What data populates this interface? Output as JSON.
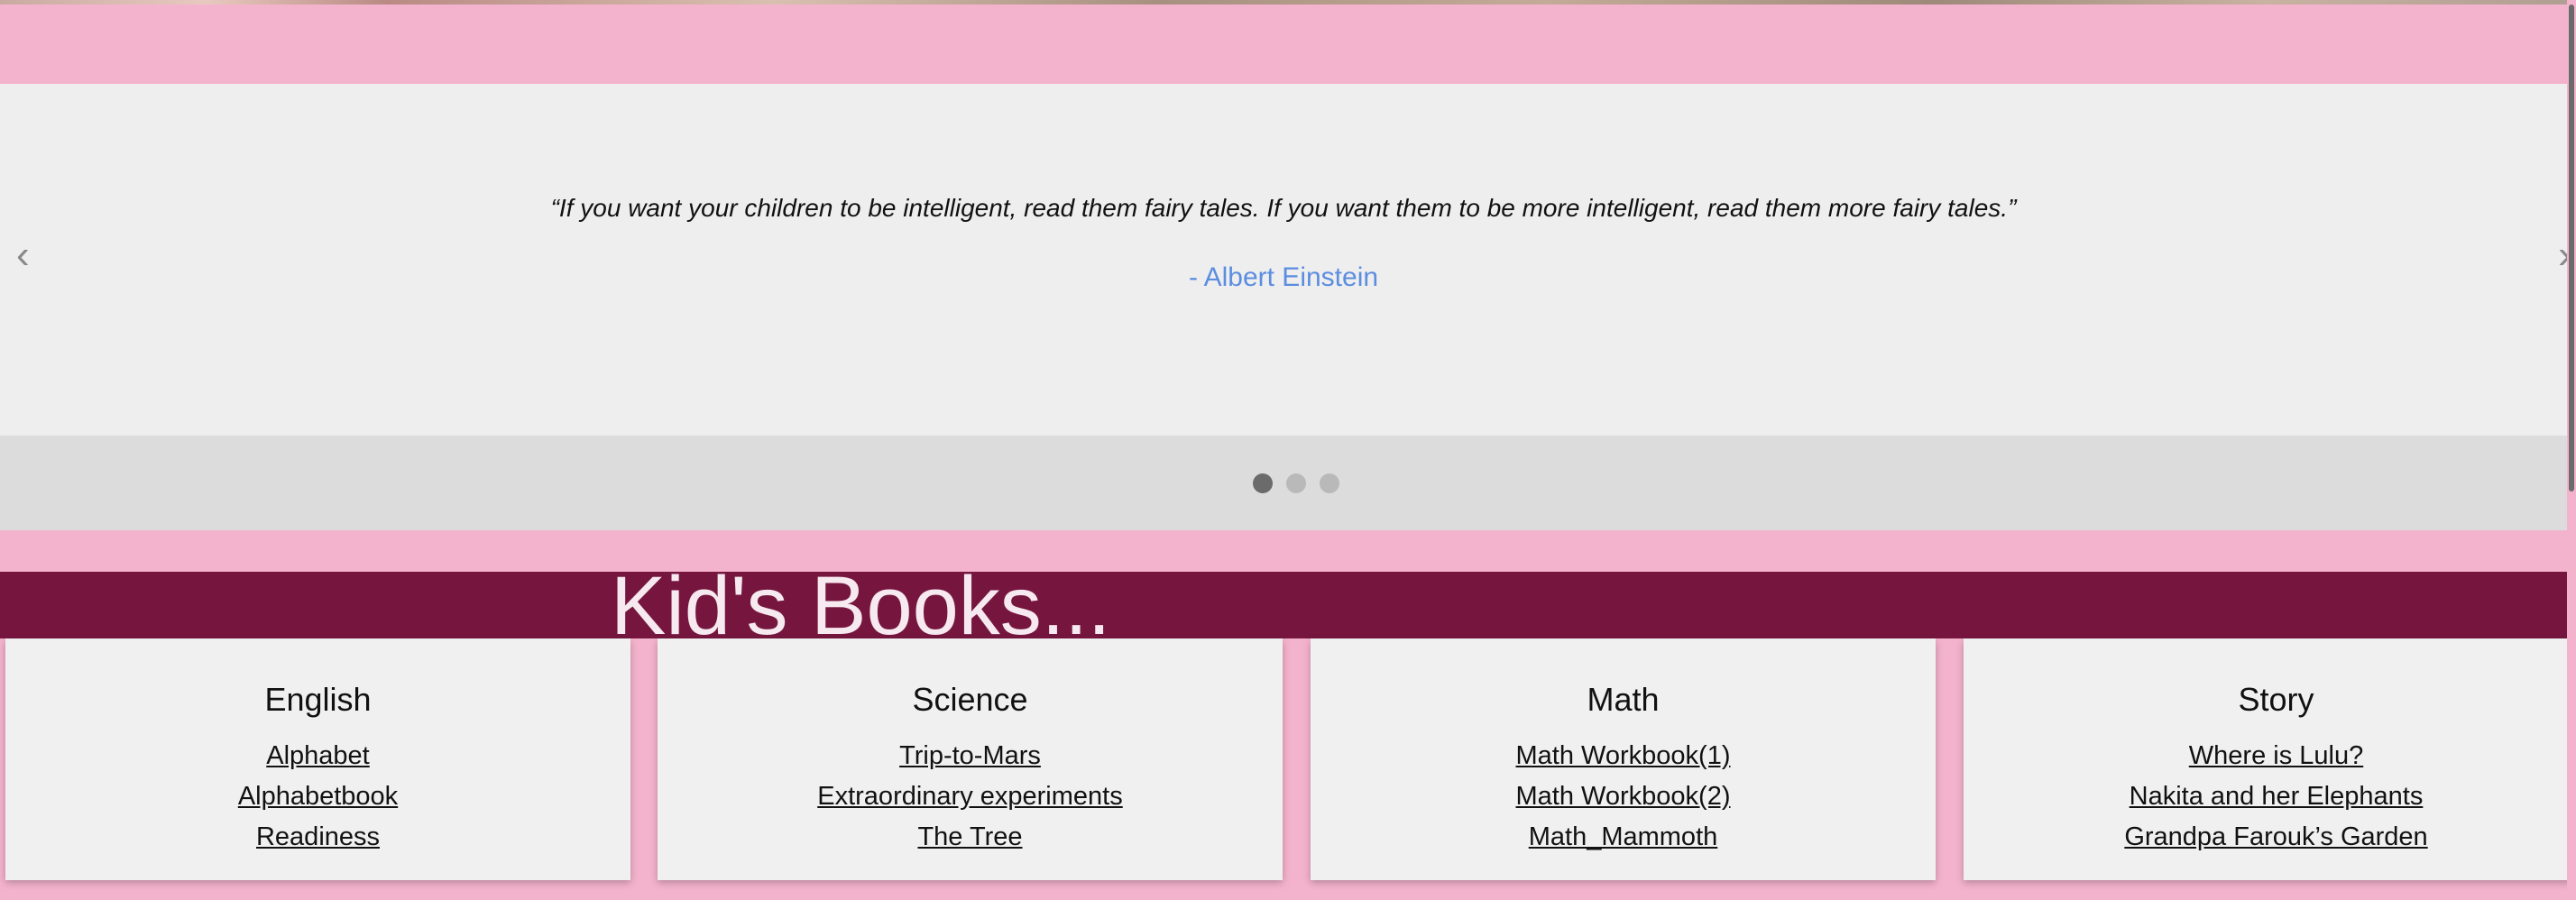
{
  "carousel": {
    "quote": "“If you want your children to be intelligent, read them fairy tales. If you want them to be more intelligent, read them more fairy tales.”",
    "author": "- Albert Einstein",
    "prev_icon": "‹",
    "next_icon": "›",
    "active_slide": 1,
    "slide_count": 3
  },
  "section": {
    "heading": "Kid's Books..."
  },
  "categories": [
    {
      "title": "English",
      "links": [
        "Alphabet",
        "Alphabetbook",
        "Readiness"
      ]
    },
    {
      "title": "Science",
      "links": [
        "Trip-to-Mars",
        "Extraordinary experiments",
        "The Tree"
      ]
    },
    {
      "title": "Math",
      "links": [
        "Math Workbook(1)",
        "Math Workbook(2)",
        "Math_Mammoth"
      ]
    },
    {
      "title": "Story",
      "links": [
        "Where is Lulu?",
        "Nakita and her Elephants",
        "Grandpa Farouk’s Garden"
      ]
    }
  ],
  "colors": {
    "page_background": "#f4b3cc",
    "heading_band": "#76163f",
    "author_text": "#5b8ee0",
    "card_background": "#f1f0f1"
  }
}
